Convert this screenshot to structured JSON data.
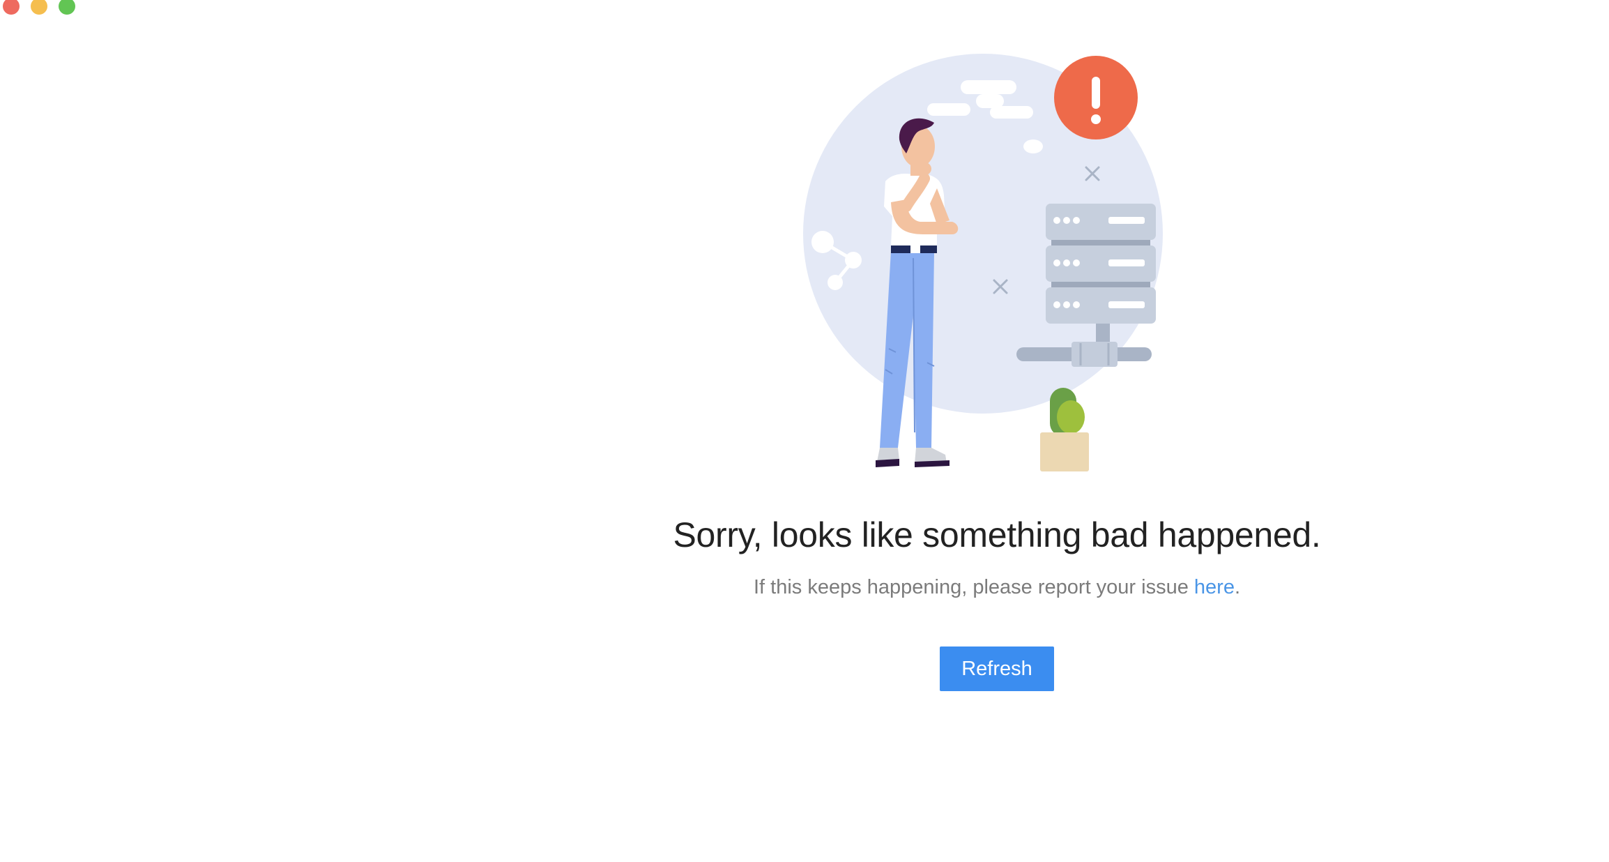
{
  "window": {
    "controls": [
      "close",
      "minimize",
      "maximize"
    ]
  },
  "error": {
    "illustration_icon": "person-and-server-error-illustration",
    "alert_symbol": "!",
    "title": "Sorry, looks like something bad happened.",
    "message_prefix": "If this keeps happening, please report your issue ",
    "link_label": "here",
    "message_suffix": ".",
    "button_label": "Refresh"
  },
  "colors": {
    "accent": "#3b8df0",
    "link": "#4a95e6",
    "alert": "#ee6a4a",
    "circle_bg": "#e4e9f6"
  }
}
